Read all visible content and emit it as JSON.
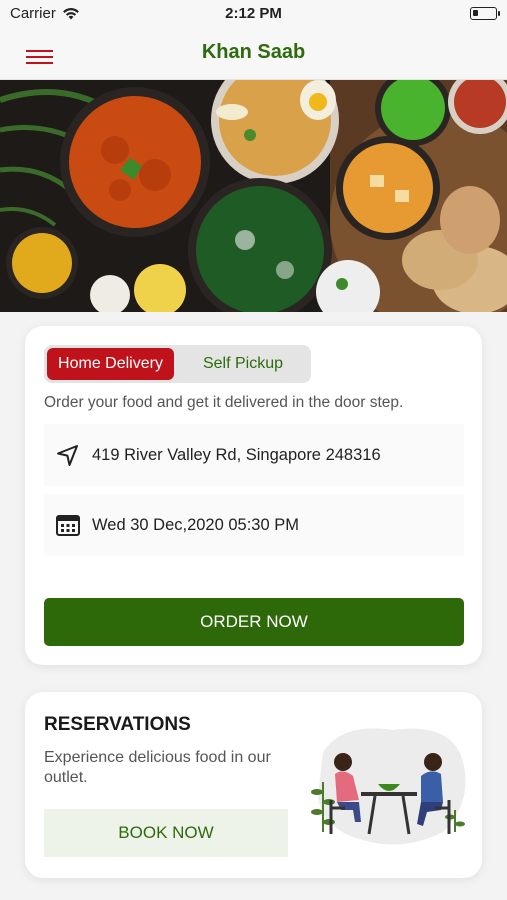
{
  "status_bar": {
    "carrier": "Carrier",
    "time": "2:12 PM",
    "battery_level": 0.25
  },
  "nav": {
    "title": "Khan Saab",
    "menu_icon": "hamburger-menu-icon"
  },
  "delivery": {
    "tabs": {
      "active": "Home Delivery",
      "inactive": "Self Pickup"
    },
    "description": "Order your food and get it delivered in the door step.",
    "address": "419 River Valley Rd, Singapore 248316",
    "address_icon": "location-arrow-icon",
    "datetime": "Wed 30 Dec,2020 05:30 PM",
    "datetime_icon": "calendar-icon",
    "order_button": "ORDER NOW"
  },
  "reservations": {
    "title": "RESERVATIONS",
    "description": "Experience delicious food in our outlet.",
    "book_button": "BOOK NOW"
  },
  "colors": {
    "brand_red": "#c0121b",
    "brand_green": "#2d6809",
    "title_green": "#2e6b0c"
  }
}
